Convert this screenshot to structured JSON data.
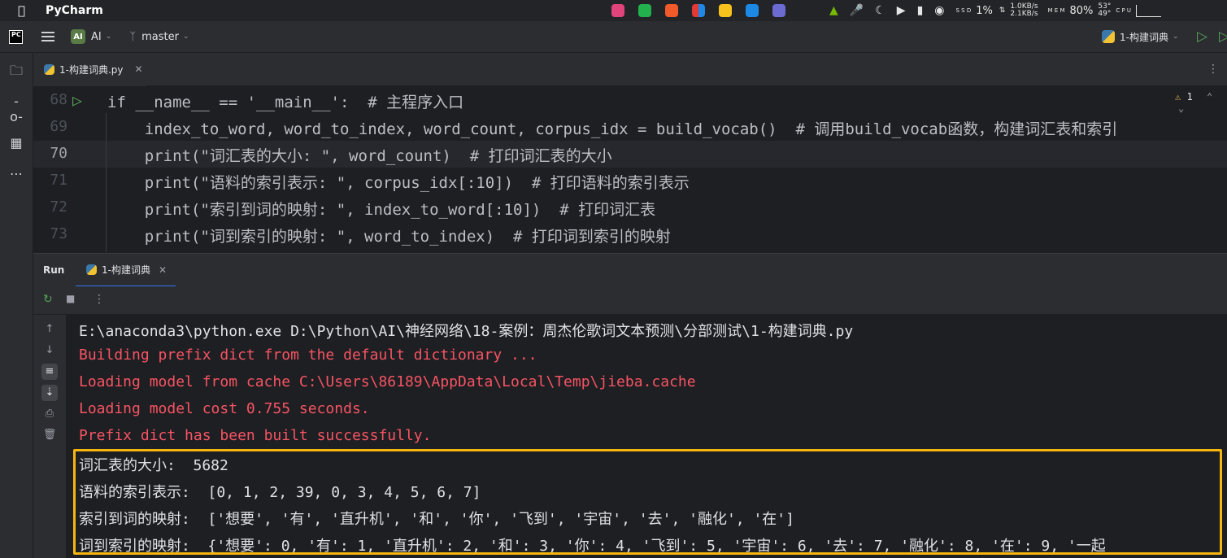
{
  "menubar": {
    "app_name": "PyCharm",
    "cpu_percent": "1%",
    "net_up": "1.0KB/s",
    "net_down": "2.1KB/s",
    "mem_percent": "80%",
    "temp_1": "53°",
    "temp_2": "49°",
    "ssd_label": "S S D",
    "mem_label": "M E M",
    "cpu_label": "C P U"
  },
  "toolbar": {
    "logo": "PC",
    "project_badge": "AI",
    "project_name": "AI",
    "branch": "master",
    "run_config": "1-构建词典"
  },
  "editor": {
    "tab_label": "1-构建词典.py",
    "warning_count": "1",
    "lines": [
      {
        "num": "68",
        "text": "if __name__ == '__main__':  # 主程序入口"
      },
      {
        "num": "69",
        "text": "    index_to_word, word_to_index, word_count, corpus_idx = build_vocab()  # 调用build_vocab函数，构建词汇表和索引"
      },
      {
        "num": "70",
        "text": "    print(\"词汇表的大小: \", word_count)  # 打印词汇表的大小"
      },
      {
        "num": "71",
        "text": "    print(\"语料的索引表示: \", corpus_idx[:10])  # 打印语料的索引表示"
      },
      {
        "num": "72",
        "text": "    print(\"索引到词的映射: \", index_to_word[:10])  # 打印词汇表"
      },
      {
        "num": "73",
        "text": "    print(\"词到索引的映射: \", word_to_index)  # 打印词到索引的映射"
      }
    ]
  },
  "run": {
    "title": "Run",
    "tab_label": "1-构建词典",
    "console": [
      {
        "type": "cmd",
        "text": "E:\\anaconda3\\python.exe D:\\Python\\AI\\神经网络\\18-案例：周杰伦歌词文本预测\\分部测试\\1-构建词典.py"
      },
      {
        "type": "err",
        "text": "Building prefix dict from the default dictionary ..."
      },
      {
        "type": "err",
        "text": "Loading model from cache C:\\Users\\86189\\AppData\\Local\\Temp\\jieba.cache"
      },
      {
        "type": "err",
        "text": "Loading model cost 0.755 seconds."
      },
      {
        "type": "err",
        "text": "Prefix dict has been built successfully."
      },
      {
        "type": "out",
        "text": "词汇表的大小:  5682"
      },
      {
        "type": "out",
        "text": "语料的索引表示:  [0, 1, 2, 39, 0, 3, 4, 5, 6, 7]"
      },
      {
        "type": "out",
        "text": "索引到词的映射:  ['想要', '有', '直升机', '和', '你', '飞到', '宇宙', '去', '融化', '在']"
      },
      {
        "type": "out",
        "text": "词到索引的映射:  {'想要': 0, '有': 1, '直升机': 2, '和': 3, '你': 4, '飞到': 5, '宇宙': 6, '去': 7, '融化': 8, '在': 9, '一起"
      }
    ]
  }
}
